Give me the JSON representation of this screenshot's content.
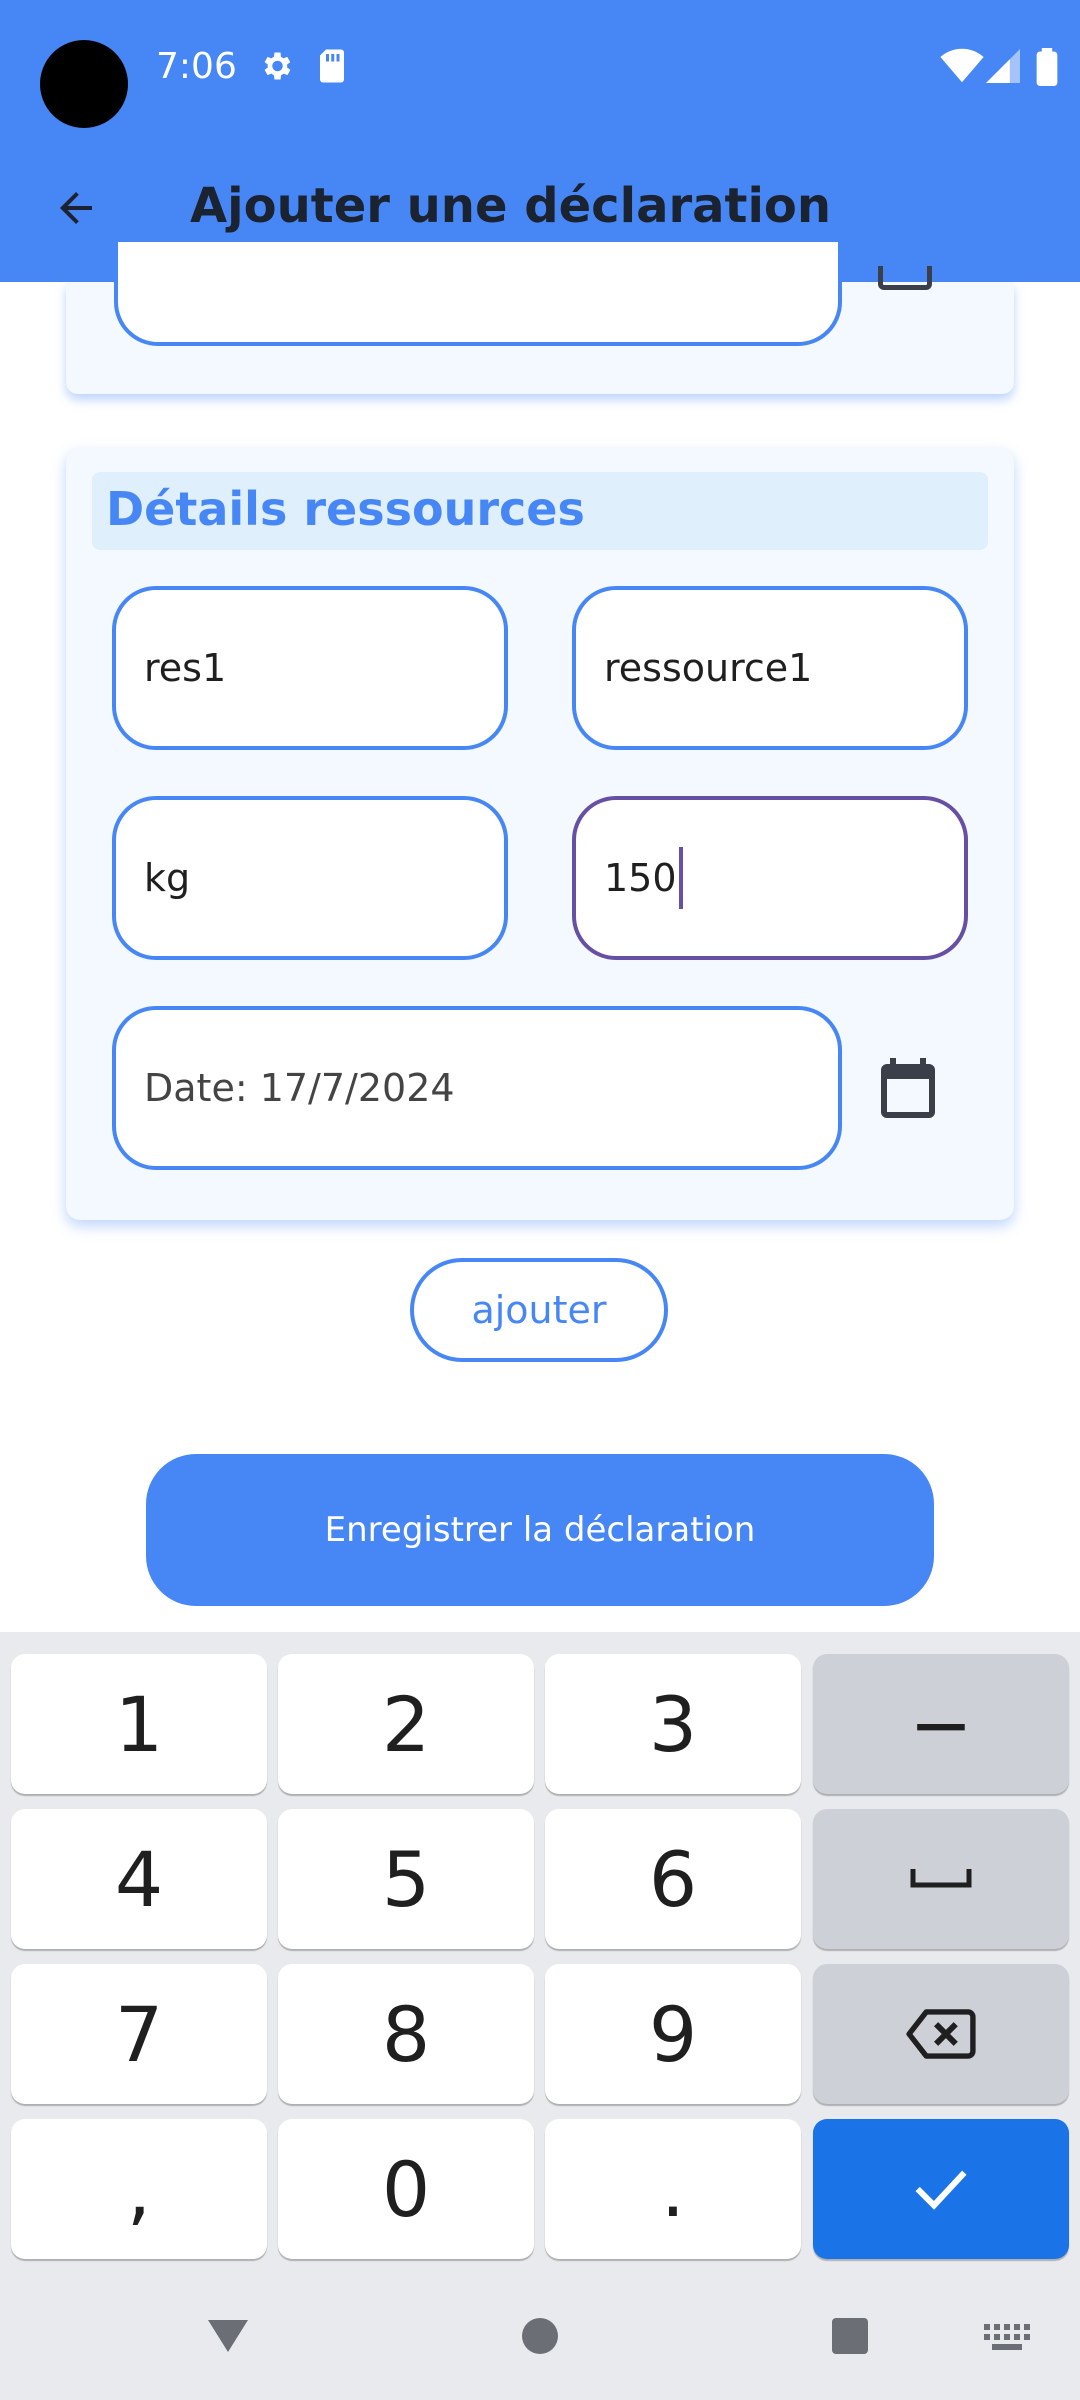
{
  "status_bar": {
    "time": "7:06",
    "icons": [
      "settings-icon",
      "sd-card-icon",
      "wifi-icon",
      "signal-icon",
      "battery-icon"
    ]
  },
  "app_bar": {
    "title": "Ajouter une déclaration",
    "back_icon": "arrow-back-icon"
  },
  "resources_card": {
    "header": "Détails ressources",
    "fields": {
      "code": "res1",
      "name": "ressource1",
      "unit": "kg",
      "quantity": "150",
      "date": "Date: 17/7/2024"
    },
    "calendar_icon": "calendar-icon"
  },
  "buttons": {
    "add_label": "ajouter",
    "save_label": "Enregistrer la déclaration"
  },
  "keyboard": {
    "keys": [
      "1",
      "2",
      "3",
      "−",
      "4",
      "5",
      "6",
      "␣",
      "7",
      "8",
      "9",
      "⌫",
      ",",
      "0",
      ".",
      "✓"
    ]
  },
  "colors": {
    "primary": "#4787f5",
    "focus": "#6750a4",
    "card_bg": "#f3f9fe",
    "keyboard_bg": "#e8eaed",
    "enter_key": "#1b73e8"
  }
}
